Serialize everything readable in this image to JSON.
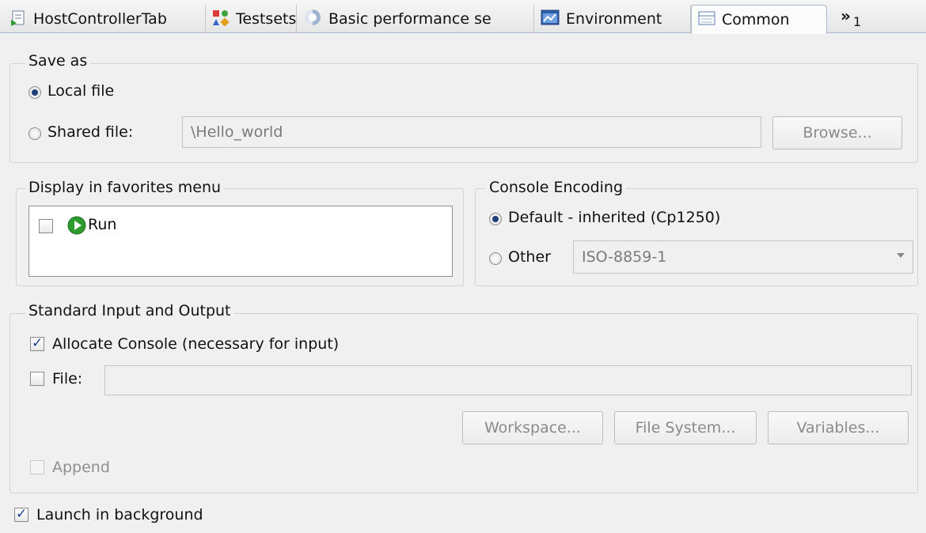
{
  "tabs": [
    {
      "label": "HostControllerTab",
      "icon": "host-controller-icon"
    },
    {
      "label": "Testsets",
      "icon": "testsets-icon"
    },
    {
      "label": "Basic performance se",
      "icon": "performance-icon"
    },
    {
      "label": "Environment",
      "icon": "environment-icon"
    },
    {
      "label": "Common",
      "icon": "common-icon",
      "active": true
    }
  ],
  "overflow": {
    "chevron": "»",
    "count": "1"
  },
  "save_as": {
    "title": "Save as",
    "local_file": "Local file",
    "shared_file": "Shared file:",
    "shared_path": "\\Hello_world",
    "browse": "Browse..."
  },
  "favorites": {
    "title": "Display in favorites menu",
    "items": [
      {
        "label": "Run",
        "icon": "run-icon",
        "checked": false
      }
    ]
  },
  "console_encoding": {
    "title": "Console Encoding",
    "default_label": "Default - inherited (Cp1250)",
    "other_label": "Other",
    "other_value": "ISO-8859-1"
  },
  "std_io": {
    "title": "Standard Input and Output",
    "allocate_console": "Allocate Console (necessary for input)",
    "file_label": "File:",
    "file_value": "",
    "workspace": "Workspace...",
    "file_system": "File System...",
    "variables": "Variables...",
    "append": "Append"
  },
  "launch_background": "Launch in background",
  "colors": {
    "accent": "#1f3f7a",
    "check": "#1b3f8f",
    "run_green": "#2e9b2e"
  }
}
